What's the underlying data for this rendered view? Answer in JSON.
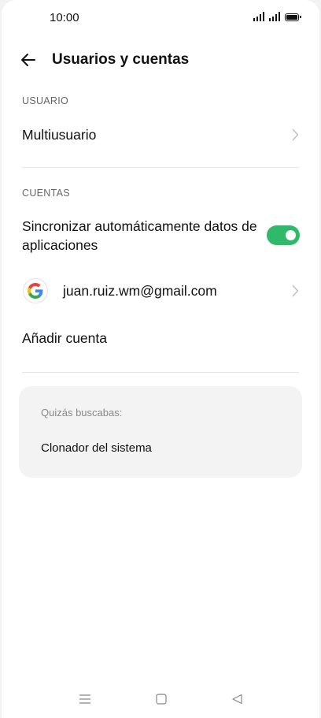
{
  "status_bar": {
    "time": "10:00"
  },
  "header": {
    "title": "Usuarios y cuentas"
  },
  "sections": {
    "usuario": {
      "label": "USUARIO",
      "multiuser": "Multiusuario"
    },
    "cuentas": {
      "label": "CUENTAS",
      "sync_label": "Sincronizar automáticamente datos de aplicaciones",
      "sync_enabled": true,
      "account_email": "juan.ruiz.wm@gmail.com",
      "add_account": "Añadir cuenta"
    }
  },
  "suggestions": {
    "hint": "Quizás buscabas:",
    "item": "Clonador del sistema"
  },
  "colors": {
    "toggle_on": "#2fb96b",
    "google_blue": "#4285F4",
    "google_red": "#EA4335",
    "google_yellow": "#FBBC05",
    "google_green": "#34A853"
  },
  "icons": [
    "back-arrow-icon",
    "chevron-right-icon",
    "google-icon",
    "menu-icon",
    "home-icon",
    "back-triangle-icon"
  ]
}
